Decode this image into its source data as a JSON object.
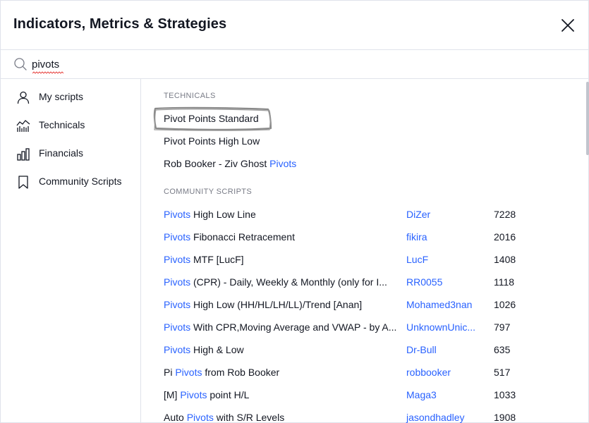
{
  "dialog": {
    "title": "Indicators, Metrics & Strategies"
  },
  "search": {
    "value": "pivots",
    "placeholder": "Search"
  },
  "sidebar": {
    "items": [
      {
        "label": "My scripts",
        "icon": "user-icon"
      },
      {
        "label": "Technicals",
        "icon": "technicals-chart-icon"
      },
      {
        "label": "Financials",
        "icon": "bar-chart-icon"
      },
      {
        "label": "Community Scripts",
        "icon": "bookmark-icon"
      }
    ]
  },
  "technicals": {
    "section_title": "TECHNICALS",
    "rows": [
      {
        "pre": "Pivot Points Standard",
        "hl": "",
        "post": ""
      },
      {
        "pre": "Pivot Points High Low",
        "hl": "",
        "post": ""
      },
      {
        "pre": "Rob Booker - Ziv Ghost ",
        "hl": "Pivots",
        "post": ""
      }
    ]
  },
  "community": {
    "section_title": "COMMUNITY SCRIPTS",
    "rows": [
      {
        "pre": "",
        "hl": "Pivots",
        "post": " High Low Line",
        "author": "DiZer",
        "count": "7228"
      },
      {
        "pre": "",
        "hl": "Pivots",
        "post": " Fibonacci Retracement",
        "author": "fikira",
        "count": "2016"
      },
      {
        "pre": "",
        "hl": "Pivots",
        "post": " MTF [LucF]",
        "author": "LucF",
        "count": "1408"
      },
      {
        "pre": "",
        "hl": "Pivots",
        "post": " (CPR) - Daily, Weekly & Monthly (only for I...",
        "author": "RR0055",
        "count": "1118"
      },
      {
        "pre": "",
        "hl": "Pivots",
        "post": " High Low (HH/HL/LH/LL)/Trend [Anan]",
        "author": "Mohamed3nan",
        "count": "1026"
      },
      {
        "pre": "",
        "hl": "Pivots",
        "post": " With CPR,Moving Average and VWAP - by A...",
        "author": "UnknownUnic...",
        "count": "797"
      },
      {
        "pre": "",
        "hl": "Pivots",
        "post": " High & Low",
        "author": "Dr-Bull",
        "count": "635"
      },
      {
        "pre": "Pi ",
        "hl": "Pivots",
        "post": " from Rob Booker",
        "author": "robbooker",
        "count": "517"
      },
      {
        "pre": "[M] ",
        "hl": "Pivots",
        "post": " point H/L",
        "author": "Maga3",
        "count": "1033"
      },
      {
        "pre": "Auto ",
        "hl": "Pivots",
        "post": " with S/R Levels",
        "author": "jasondhadley",
        "count": "1908"
      }
    ]
  },
  "colors": {
    "accent": "#2962ff",
    "text": "#131722",
    "muted": "#787b86",
    "border": "#e0e3eb"
  }
}
